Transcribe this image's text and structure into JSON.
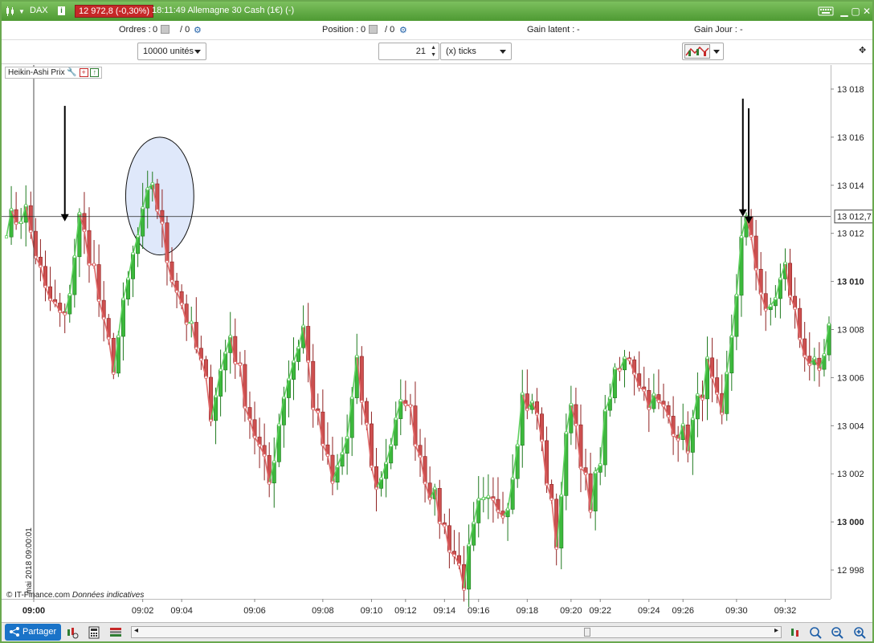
{
  "titlebar": {
    "instrument": "DAX",
    "price_badge": "12 972,8 (-0,30%)",
    "title": "18:11:49 Allemagne 30 Cash (1€) (-)"
  },
  "infobar": {
    "orders_label": "Ordres :",
    "orders_value": "0",
    "orders_sep": "/ 0",
    "position_label": "Position :",
    "position_value": "0",
    "position_sep": "/ 0",
    "gain_latent_label": "Gain latent :",
    "gain_latent_value": "-",
    "gain_jour_label": "Gain Jour :",
    "gain_jour_value": "-"
  },
  "controls": {
    "units": "10000 unités",
    "ticks_value": "21",
    "ticks_unit": "(x) ticks"
  },
  "indicator": {
    "label": "Heikin-Ashi Prix"
  },
  "footer": {
    "copyright": "© IT-Finance.com",
    "note": "Données indicatives",
    "vertical_date": "mai 2018 09:00:01",
    "share_label": "Partager"
  },
  "colors": {
    "up": "#3cb93c",
    "down": "#cd4f4f",
    "line_up": "#5fd15f",
    "line_down": "#e06a6a",
    "ellipse_fill": "#dfe8fa"
  },
  "chart_data": {
    "type": "candlestick",
    "title": "",
    "xlabel": "",
    "ylabel": "",
    "ylim": [
      12996.8,
      13019.0
    ],
    "yticks": [
      "13 018",
      "13 016",
      "13 014",
      "13 012",
      "13 010",
      "13 008",
      "13 006",
      "13 004",
      "13 002",
      "13 000",
      "12 998"
    ],
    "ytick_values": [
      13018,
      13016,
      13014,
      13012,
      13010,
      13008,
      13006,
      13004,
      13002,
      13000,
      12998
    ],
    "bold_ytick_values": [
      13010,
      13000
    ],
    "current_price_label": "13 012,7",
    "current_price": 13012.7,
    "xticks": [
      "09:00",
      "09:02",
      "09:04",
      "09:06",
      "09:08",
      "09:10",
      "09:12",
      "09:14",
      "09:16",
      "09:18",
      "09:20",
      "09:22",
      "09:24",
      "09:26",
      "09:30",
      "09:32"
    ],
    "xtick_index": [
      0,
      28,
      36,
      51,
      65,
      75,
      82,
      90,
      97,
      107,
      116,
      122,
      132,
      139,
      150,
      160
    ],
    "bold_xtick": "09:00",
    "candle_count": 170,
    "waypoints": [
      [
        0,
        13012.4
      ],
      [
        4,
        13012.9
      ],
      [
        8,
        13009.5
      ],
      [
        12,
        13008.3
      ],
      [
        15,
        13012.6
      ],
      [
        18,
        13010.5
      ],
      [
        20,
        13008.0
      ],
      [
        22,
        13006.6
      ],
      [
        26,
        13011.0
      ],
      [
        30,
        13014.2
      ],
      [
        33,
        13011.0
      ],
      [
        35,
        13009.8
      ],
      [
        40,
        13006.5
      ],
      [
        42,
        13004.7
      ],
      [
        46,
        13007.8
      ],
      [
        50,
        13004.4
      ],
      [
        54,
        13001.6
      ],
      [
        57,
        13005.4
      ],
      [
        61,
        13008.1
      ],
      [
        63,
        13005.0
      ],
      [
        67,
        13001.5
      ],
      [
        70,
        13003.5
      ],
      [
        72,
        13006.4
      ],
      [
        76,
        13001.3
      ],
      [
        82,
        13005.3
      ],
      [
        86,
        13002.0
      ],
      [
        90,
        12999.7
      ],
      [
        94,
        12997.6
      ],
      [
        97,
        13000.5
      ],
      [
        103,
        13000.8
      ],
      [
        106,
        13005.2
      ],
      [
        109,
        13004.5
      ],
      [
        113,
        12999.2
      ],
      [
        116,
        13005.3
      ],
      [
        120,
        13000.3
      ],
      [
        124,
        13005.5
      ],
      [
        128,
        13007.0
      ],
      [
        131,
        13005.4
      ],
      [
        136,
        13004.4
      ],
      [
        140,
        13003.3
      ],
      [
        144,
        13006.4
      ],
      [
        147,
        13004.0
      ],
      [
        151,
        13011.6
      ],
      [
        152.5,
        13012.6
      ],
      [
        156,
        13008.4
      ],
      [
        160,
        13010.5
      ],
      [
        163,
        13007.7
      ],
      [
        167,
        13005.8
      ],
      [
        169,
        13007.8
      ]
    ],
    "annotations": [
      {
        "type": "arrow-down",
        "index": 12,
        "value_top": 13017.3,
        "value_tip": 13012.5
      },
      {
        "type": "arrow-down",
        "index": 151.3,
        "value_top": 13017.6,
        "value_tip": 13012.7
      },
      {
        "type": "arrow-down",
        "index": 152.5,
        "value_top": 13017.2,
        "value_tip": 13012.4
      },
      {
        "type": "ellipse",
        "index_from": 24.5,
        "index_to": 38.5,
        "value_from": 13011.1,
        "value_to": 13016.0
      }
    ]
  }
}
